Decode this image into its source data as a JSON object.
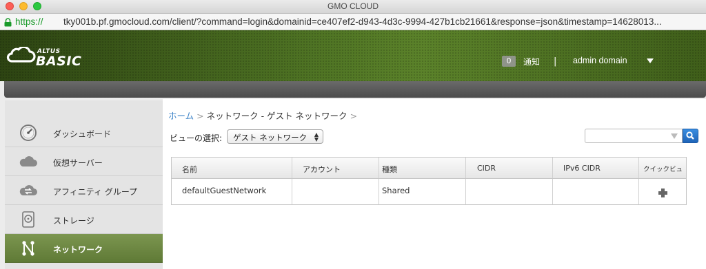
{
  "window": {
    "title": "GMO CLOUD"
  },
  "address_bar": {
    "secure_prefix": "https://",
    "url": "tky001b.pf.gmocloud.com/client/?command=login&domainid=ce407ef2-d943-4d3c-9994-427b1cb21661&response=json&timestamp=14628013..."
  },
  "header": {
    "logo_small": "ALTUS",
    "logo_big": "BASIC",
    "notice_count": "0",
    "notice_label": "通知",
    "separator": "|",
    "user": "admin domain"
  },
  "sidebar": {
    "items": [
      {
        "label": "ダッシュボード",
        "icon": "dashboard-gauge-icon"
      },
      {
        "label": "仮想サーバー",
        "icon": "cloud-icon"
      },
      {
        "label": "アフィニティ グループ",
        "icon": "affinity-cloud-icon"
      },
      {
        "label": "ストレージ",
        "icon": "storage-disk-icon"
      },
      {
        "label": "ネットワーク",
        "icon": "network-icon",
        "active": true
      }
    ]
  },
  "breadcrumb": {
    "home": "ホーム",
    "sep": ">",
    "current": "ネットワーク - ゲスト ネットワーク",
    "trail": ">"
  },
  "view": {
    "label": "ビューの選択:",
    "selected": "ゲスト ネットワーク"
  },
  "search": {
    "placeholder": ""
  },
  "table": {
    "headers": [
      "名前",
      "アカウント",
      "種類",
      "CIDR",
      "IPv6 CIDR",
      "クイックビュ"
    ],
    "rows": [
      {
        "name": "defaultGuestNetwork",
        "account": "",
        "type": "Shared",
        "cidr": "",
        "ipv6": ""
      }
    ]
  },
  "colors": {
    "accent": "#3e84c8",
    "active_nav": "#6d8742",
    "header_green": "#4f7424"
  }
}
